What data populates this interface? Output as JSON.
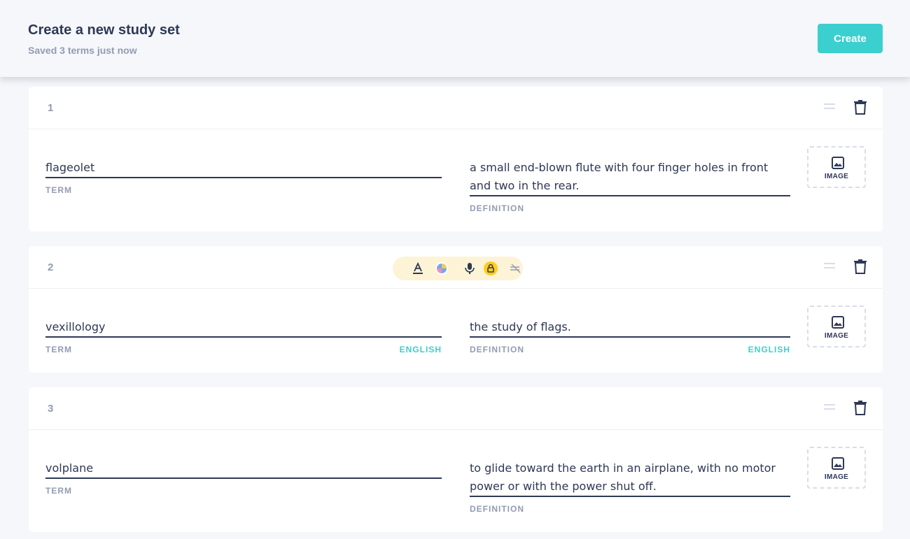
{
  "header": {
    "title": "Create a new study set",
    "subtitle": "Saved 3 terms just now",
    "create_label": "Create"
  },
  "cards": [
    {
      "number": "1",
      "term": "flageolet",
      "term_label": "TERM",
      "definition": "a small end-blown flute with four finger holes in front and two in the rear.",
      "definition_label": "DEFINITION",
      "image_label": "IMAGE"
    },
    {
      "number": "2",
      "term": "vexillology",
      "term_label": "TERM",
      "term_lang": "ENGLISH",
      "definition": "the study of flags.",
      "definition_label": "DEFINITION",
      "definition_lang": "ENGLISH",
      "image_label": "IMAGE"
    },
    {
      "number": "3",
      "term": "volplane",
      "term_label": "TERM",
      "definition": "to glide toward the earth in an airplane, with no motor power or with the power shut off.",
      "definition_label": "DEFINITION",
      "image_label": "IMAGE"
    }
  ],
  "toolbar_icons": [
    "text-format-icon",
    "color-palette-icon",
    "microphone-icon",
    "lock-icon",
    "unsync-icon"
  ],
  "colors": {
    "accent": "#3ccfcf",
    "text": "#2e3856",
    "muted": "#939bb4",
    "toolbar_bg": "#fdf3d6",
    "lock_badge": "#ffcd1f"
  }
}
